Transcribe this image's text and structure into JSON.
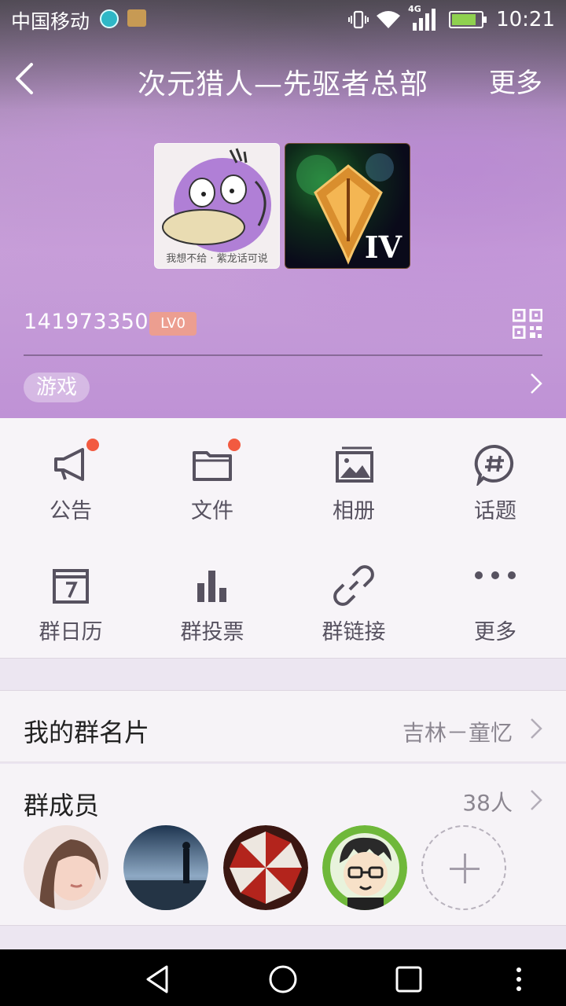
{
  "status_bar": {
    "carrier": "中国移动",
    "network_tag": "4G",
    "time": "10:21",
    "icons": [
      "alarm-icon",
      "health-app-icon",
      "vibrate-icon",
      "wifi-icon",
      "signal-icon",
      "battery-charging-icon"
    ]
  },
  "nav": {
    "title": "次元猎人—先驱者总部",
    "more_label": "更多",
    "back_icon": "back-arrow-icon"
  },
  "header": {
    "avatar_caption": "我想不给 · 紫龙话可说",
    "avatar2_numeral": "IV",
    "group_id": "141973350",
    "level": "LV0",
    "tag": "游戏"
  },
  "features": [
    {
      "label": "公告",
      "icon": "megaphone-icon",
      "badge": true
    },
    {
      "label": "文件",
      "icon": "folder-icon",
      "badge": true
    },
    {
      "label": "相册",
      "icon": "album-icon",
      "badge": false
    },
    {
      "label": "话题",
      "icon": "hashtag-icon",
      "badge": false
    },
    {
      "label": "群日历",
      "icon": "calendar-icon",
      "badge": false
    },
    {
      "label": "群投票",
      "icon": "bar-chart-icon",
      "badge": false
    },
    {
      "label": "群链接",
      "icon": "link-icon",
      "badge": false
    },
    {
      "label": "更多",
      "icon": "more-dots-icon",
      "badge": false
    }
  ],
  "group_card": {
    "label": "我的群名片",
    "value": "吉林－童忆"
  },
  "members": {
    "label": "群成员",
    "count": "38人"
  },
  "colors": {
    "accent_dot": "#f25a40",
    "level_badge": "#ec9e90",
    "icon_gray": "#575260"
  }
}
